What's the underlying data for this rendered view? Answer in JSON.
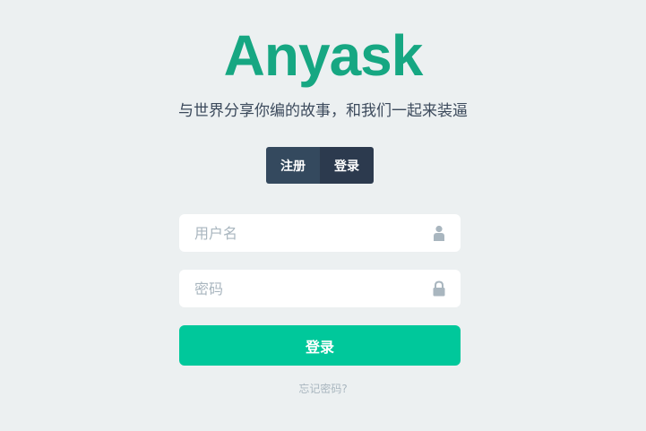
{
  "brand": {
    "logo_text": "Anyask",
    "tagline": "与世界分享你编的故事，和我们一起来装逼"
  },
  "tabs": [
    {
      "label": "注册"
    },
    {
      "label": "登录"
    }
  ],
  "form": {
    "username_placeholder": "用户名",
    "username_value": "",
    "username_icon": "user-icon",
    "password_placeholder": "密码",
    "password_value": "",
    "password_icon": "lock-icon",
    "submit_label": "登录",
    "forgot_label": "忘记密码?"
  },
  "colors": {
    "brand_green": "#16a782",
    "button_green": "#00c89b",
    "tab_dark": "#2c3a4e",
    "tab_register": "#34495e",
    "background": "#ecf0f1",
    "placeholder": "#a9b6bf"
  }
}
